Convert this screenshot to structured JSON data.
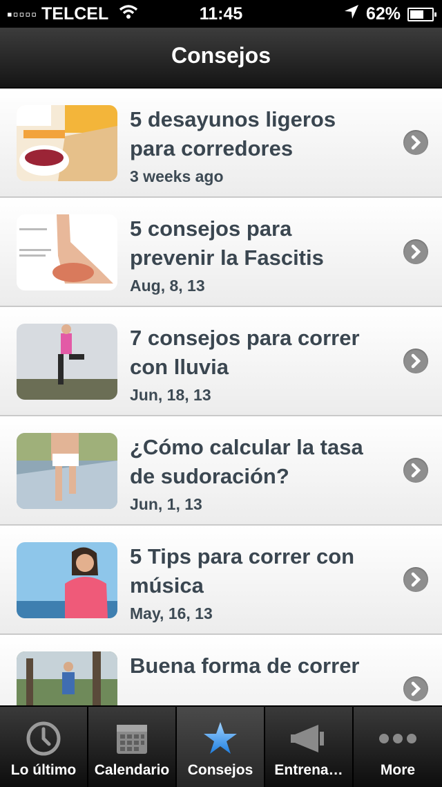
{
  "status": {
    "carrier": "TELCEL",
    "time": "11:45",
    "battery": "62%",
    "battery_level": 0.62
  },
  "nav": {
    "title": "Consejos"
  },
  "articles": [
    {
      "title": "5 desayunos ligeros para corredores",
      "date": "3 weeks ago",
      "thumb": "breakfast"
    },
    {
      "title": "5 consejos para prevenir la Fascitis",
      "date": "Aug, 8, 13",
      "thumb": "foot"
    },
    {
      "title": "7 consejos para correr con lluvia",
      "date": "Jun, 18, 13",
      "thumb": "runner-rain"
    },
    {
      "title": "¿Cómo calcular la tasa de sudoración?",
      "date": "Jun, 1, 13",
      "thumb": "runner-legs"
    },
    {
      "title": "5 Tips para correr con música",
      "date": "May, 16, 13",
      "thumb": "woman-music"
    },
    {
      "title": "Buena forma de correr",
      "date": "",
      "thumb": "runner-trail"
    }
  ],
  "tabs": [
    {
      "label": "Lo último",
      "icon": "clock-icon"
    },
    {
      "label": "Calendario",
      "icon": "calendar-icon"
    },
    {
      "label": "Consejos",
      "icon": "star-icon",
      "active": true
    },
    {
      "label": "Entrena",
      "icon": "megaphone-icon"
    },
    {
      "label": "More",
      "icon": "more-icon"
    }
  ]
}
